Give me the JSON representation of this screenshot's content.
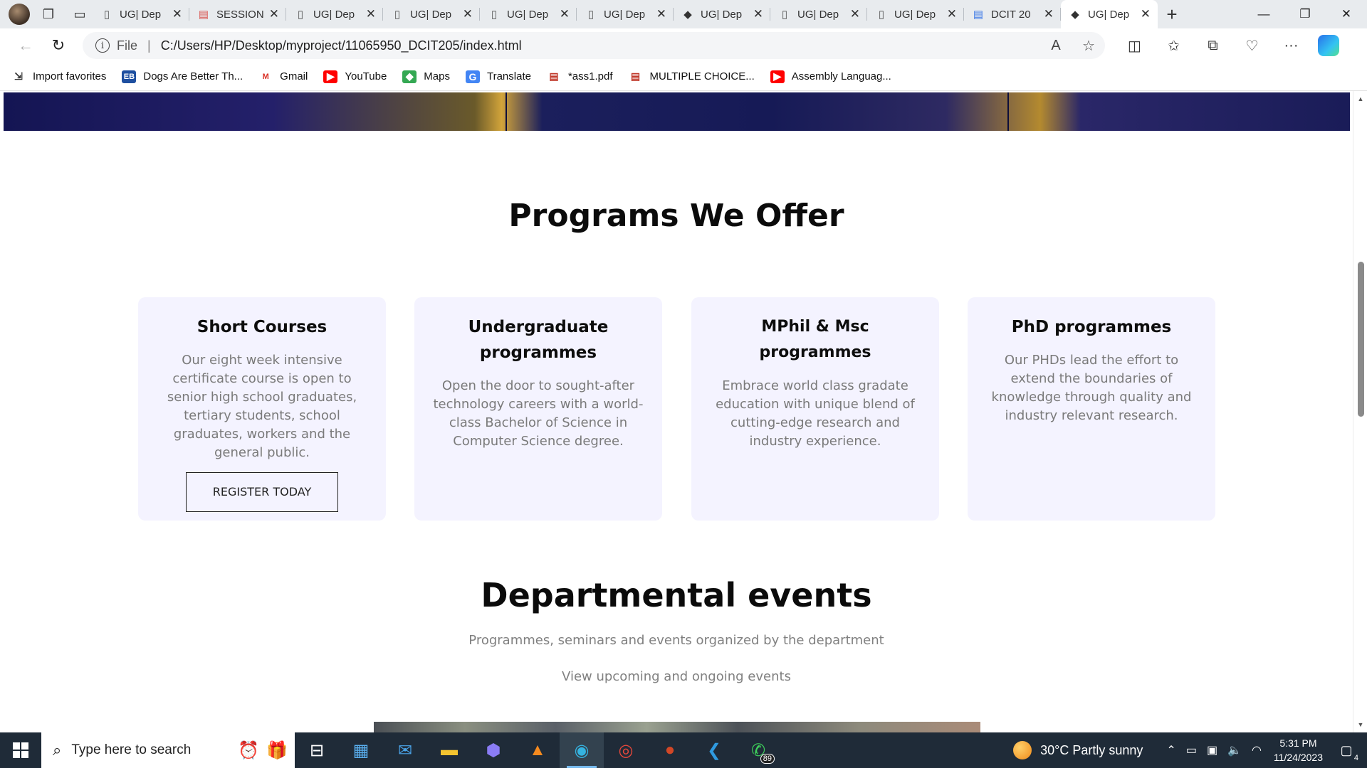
{
  "browser": {
    "tabs": [
      {
        "label": "UG| Dep",
        "favicon": "page-icon"
      },
      {
        "label": "SESSION",
        "favicon": "pdf-icon"
      },
      {
        "label": "UG| Dep",
        "favicon": "page-icon"
      },
      {
        "label": "UG| Dep",
        "favicon": "page-icon"
      },
      {
        "label": "UG| Dep",
        "favicon": "page-icon"
      },
      {
        "label": "UG| Dep",
        "favicon": "page-icon"
      },
      {
        "label": "UG| Dep",
        "favicon": "site-icon"
      },
      {
        "label": "UG| Dep",
        "favicon": "page-icon"
      },
      {
        "label": "UG| Dep",
        "favicon": "page-icon"
      },
      {
        "label": "DCIT 20",
        "favicon": "docs-icon"
      },
      {
        "label": "UG| Dep",
        "favicon": "site-icon",
        "active": true
      }
    ],
    "address": {
      "scheme": "File",
      "url": "C:/Users/HP/Desktop/myproject/11065950_DCIT205/index.html"
    },
    "favorites": [
      {
        "label": "Import favorites",
        "icon": "import-icon"
      },
      {
        "label": "Dogs Are Better Th...",
        "icon": "eb-icon",
        "badge": "EB"
      },
      {
        "label": "Gmail",
        "icon": "gmail-icon",
        "badge": "M"
      },
      {
        "label": "YouTube",
        "icon": "youtube-icon"
      },
      {
        "label": "Maps",
        "icon": "maps-icon"
      },
      {
        "label": "Translate",
        "icon": "translate-icon"
      },
      {
        "label": "*ass1.pdf",
        "icon": "pdf-icon"
      },
      {
        "label": "MULTIPLE CHOICE...",
        "icon": "pdf-icon"
      },
      {
        "label": "Assembly Languag...",
        "icon": "youtube-icon"
      }
    ]
  },
  "page": {
    "programs_title": "Programs We Offer",
    "programs": [
      {
        "title": "Short Courses",
        "description": "Our eight week intensive certificate course is open to senior high school graduates, tertiary students, school graduates, workers and the general public.",
        "button": "REGISTER TODAY"
      },
      {
        "title": "Undergraduate programmes",
        "description": "Open the door to sought-after technology careers with a world-class Bachelor of Science in Computer Science degree."
      },
      {
        "title": "MPhil & Msc programmes",
        "description": "Embrace world class gradate education with unique blend of cutting-edge research and industry experience."
      },
      {
        "title": "PhD programmes",
        "description": "Our PHDs lead the effort to extend the boundaries of knowledge through quality and industry relevant research."
      }
    ],
    "events_title": "Departmental events",
    "events_subtitle": "Programmes, seminars and events organized by the department",
    "events_link": "View upcoming and ongoing events"
  },
  "taskbar": {
    "search_placeholder": "Type here to search",
    "apps": [
      "alarm-icon",
      "gift-icon",
      "task-view-icon",
      "store-icon",
      "mail-icon",
      "file-explorer-icon",
      "video-editor-icon",
      "vlc-icon",
      "edge-icon",
      "chrome-icon",
      "powerpoint-icon",
      "vscode-icon",
      "whatsapp-icon"
    ],
    "whatsapp_badge": "89",
    "weather": "30°C  Partly sunny",
    "time": "5:31 PM",
    "date": "11/24/2023",
    "notifications": "4"
  },
  "colors": {
    "accent_card": "#f4f3ff",
    "taskbar": "#1f2b38",
    "tab_strip": "#e8ebee"
  }
}
